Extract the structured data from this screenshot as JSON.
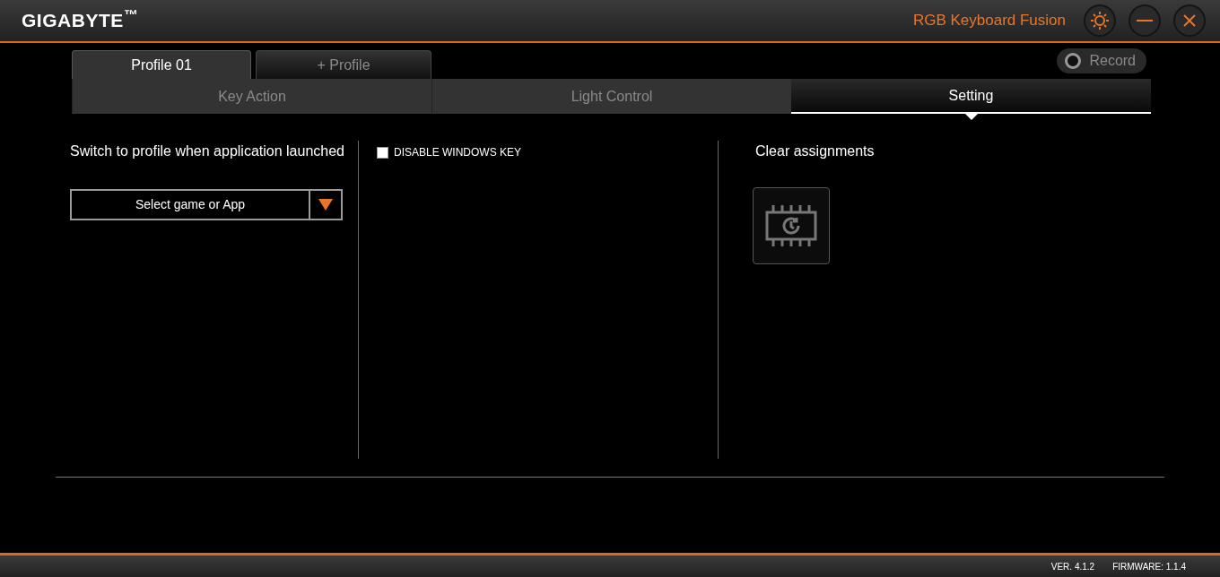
{
  "header": {
    "logo": "GIGABYTE$^{™}$",
    "title": "RGB Keyboard Fusion"
  },
  "profile_tabs": [
    {
      "label": "Profile 01",
      "selected": true
    },
    {
      "label": "+ Profile",
      "selected": false
    }
  ],
  "record": {
    "label": "Record"
  },
  "tabs": [
    {
      "label": "Key Action",
      "selected": false
    },
    {
      "label": "Light Control",
      "selected": false
    },
    {
      "label": "Setting",
      "selected": true
    }
  ],
  "switch_profile": {
    "heading": "Switch to profile when application launched",
    "dropdown": "Select game or App"
  },
  "disable_windows_key": {
    "label": "DISABLE WINDOWS KEY",
    "checked": false
  },
  "clear_assignments": {
    "heading": "Clear assignments"
  },
  "status_bar": {
    "version": "VER. 4.1.2",
    "firmware": "FIRMWARE: 1.1.4"
  }
}
